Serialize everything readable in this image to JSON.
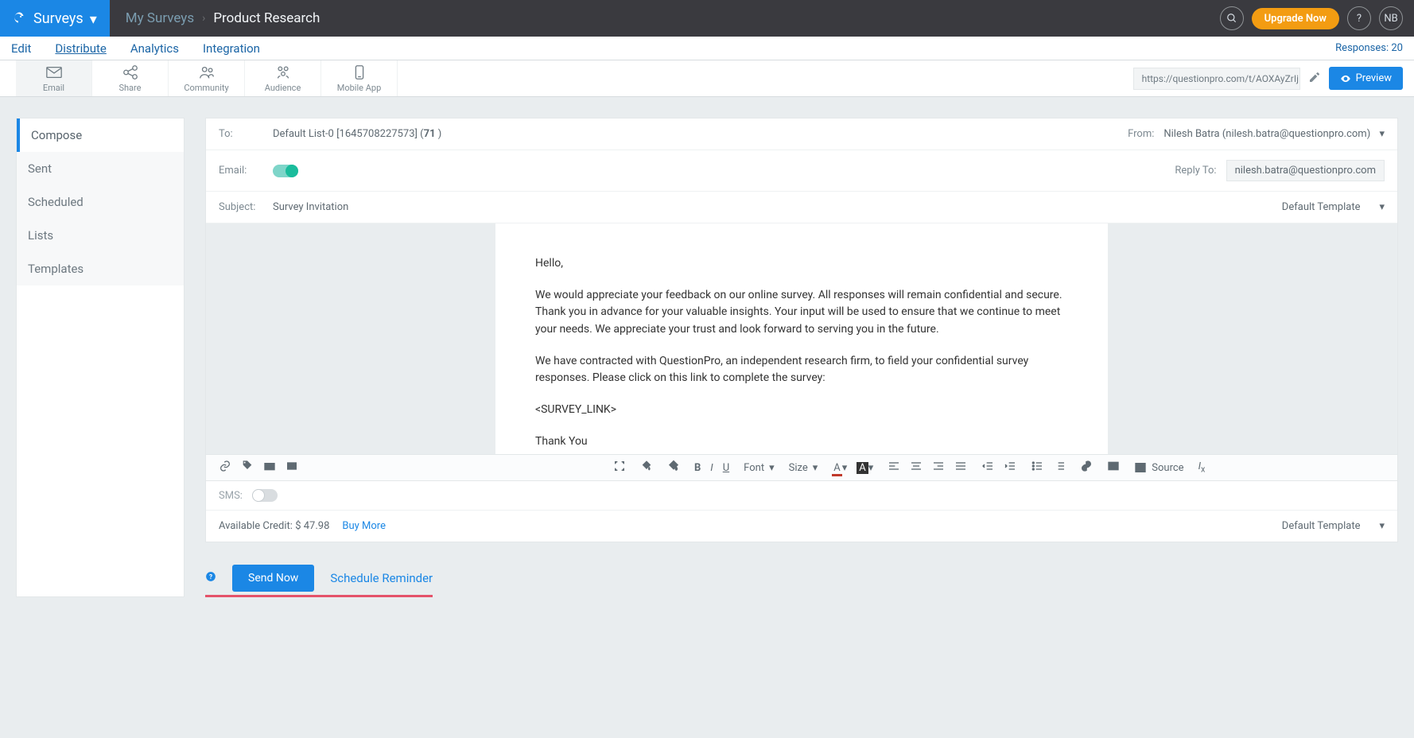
{
  "header": {
    "brand": "Surveys",
    "breadcrumb": {
      "root": "My Surveys",
      "current": "Product Research"
    },
    "upgrade_label": "Upgrade Now",
    "avatar_initials": "NB"
  },
  "nav": {
    "items": [
      "Edit",
      "Distribute",
      "Analytics",
      "Integration"
    ],
    "active_index": 1,
    "responses_label": "Responses:",
    "responses_count": "20"
  },
  "tooltabs": {
    "items": [
      {
        "label": "Email"
      },
      {
        "label": "Share"
      },
      {
        "label": "Community"
      },
      {
        "label": "Audience"
      },
      {
        "label": "Mobile App"
      }
    ],
    "active_index": 0,
    "survey_url": "https://questionpro.com/t/AOXAyZrIjI",
    "preview_label": "Preview"
  },
  "sidebar": {
    "items": [
      "Compose",
      "Sent",
      "Scheduled",
      "Lists",
      "Templates"
    ],
    "active_index": 0
  },
  "compose": {
    "to_label": "To:",
    "to_value_prefix": "Default List-0 [1645708227573] (",
    "to_count": "71",
    "to_value_suffix": " )",
    "from_label": "From:",
    "from_value": "Nilesh Batra (nilesh.batra@questionpro.com)",
    "email_label": "Email:",
    "replyto_label": "Reply To:",
    "replyto_value": "nilesh.batra@questionpro.com",
    "subject_label": "Subject:",
    "subject_value": "Survey Invitation",
    "template_label": "Default Template",
    "body_greeting": "Hello,",
    "body_para1": "We would appreciate your feedback on our online survey. All responses will remain confidential and secure. Thank you in advance for your valuable insights. Your input will be used to ensure that we continue to meet your needs. We appreciate your trust and look forward to serving you in the future.",
    "body_para2": "We have contracted with QuestionPro, an independent research firm, to field your confidential survey responses. Please click on this link to complete the survey:",
    "body_link_placeholder": "<SURVEY_LINK>",
    "body_thanks": "Thank You"
  },
  "editor_toolbar": {
    "font_label": "Font",
    "size_label": "Size",
    "source_label": "Source"
  },
  "sms": {
    "label": "SMS:"
  },
  "credit": {
    "label": "Available Credit:",
    "amount": "$ 47.98",
    "buy_more": "Buy More",
    "template_label": "Default Template"
  },
  "actions": {
    "send_label": "Send Now",
    "schedule_label": "Schedule Reminder"
  }
}
